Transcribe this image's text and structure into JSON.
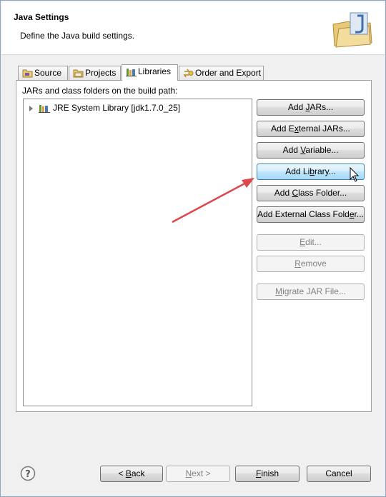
{
  "header": {
    "title": "Java Settings",
    "subtitle": "Define the Java build settings.",
    "icon": "folder-jar-icon"
  },
  "tabs": [
    {
      "label": "Source",
      "icon": "source-folder-icon",
      "active": false
    },
    {
      "label": "Projects",
      "icon": "projects-icon",
      "active": false
    },
    {
      "label": "Libraries",
      "icon": "libraries-icon",
      "active": true
    },
    {
      "label": "Order and Export",
      "icon": "order-export-icon",
      "active": false
    }
  ],
  "libraries": {
    "label": "JARs and class folders on the build path:",
    "tree": [
      {
        "label": "JRE System Library [jdk1.7.0_25]",
        "icon": "library-icon",
        "expanded": false
      }
    ],
    "buttons": [
      {
        "pre": "Add ",
        "mn": "J",
        "post": "ARs...",
        "enabled": true
      },
      {
        "pre": "Add E",
        "mn": "x",
        "post": "ternal JARs...",
        "enabled": true
      },
      {
        "pre": "Add ",
        "mn": "V",
        "post": "ariable...",
        "enabled": true
      },
      {
        "pre": "Add Li",
        "mn": "b",
        "post": "rary...",
        "enabled": true,
        "hover": true
      },
      {
        "pre": "Add ",
        "mn": "C",
        "post": "lass Folder...",
        "enabled": true
      },
      {
        "pre": "Add External Class Fold",
        "mn": "e",
        "post": "r...",
        "enabled": true
      },
      {
        "pre": "",
        "mn": "E",
        "post": "dit...",
        "enabled": false
      },
      {
        "pre": "",
        "mn": "R",
        "post": "emove",
        "enabled": false
      },
      {
        "pre": "",
        "mn": "M",
        "post": "igrate JAR File...",
        "enabled": false
      }
    ]
  },
  "footer": {
    "help_icon": "help-icon",
    "back": {
      "pre": "< ",
      "mn": "B",
      "post": "ack"
    },
    "next": {
      "pre": "",
      "mn": "N",
      "post": "ext >"
    },
    "finish": {
      "pre": "",
      "mn": "F",
      "post": "inish"
    },
    "cancel": {
      "label": "Cancel"
    }
  },
  "colors": {
    "annotation_arrow": "#e0474c",
    "hover_border": "#3c7fb1"
  }
}
